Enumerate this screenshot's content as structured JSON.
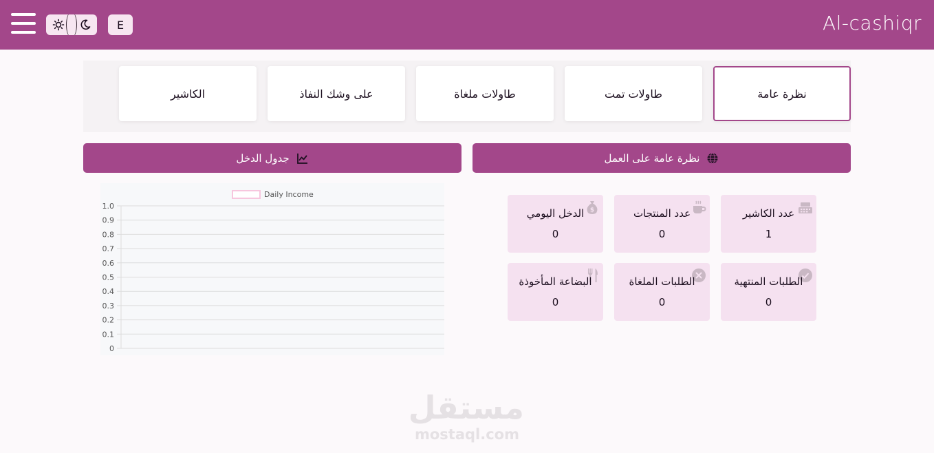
{
  "header": {
    "logo": "Al-cashiqr",
    "lang_button": "E",
    "background_color": "#a3478a"
  },
  "tabs": [
    {
      "label": "نظرة عامة",
      "active": true
    },
    {
      "label": "طاولات تمت",
      "active": false
    },
    {
      "label": "طاولات ملغاة",
      "active": false
    },
    {
      "label": "على وشك النفاذ",
      "active": false
    },
    {
      "label": "الكاشير",
      "active": false
    }
  ],
  "sections": {
    "overview_title": "نظرة عامة على العمل",
    "income_title": "جدول الدخل"
  },
  "stats": [
    {
      "label": "عدد الكاشير",
      "value": "1",
      "icon": "cash-register-icon"
    },
    {
      "label": "عدد المنتجات",
      "value": "0",
      "icon": "coffee-cup-icon"
    },
    {
      "label": "الدخل اليومي",
      "value": "0",
      "icon": "money-bag-icon"
    },
    {
      "label": "الطلبات المنتهية",
      "value": "0",
      "icon": "check-circle-icon"
    },
    {
      "label": "الطلبات الملغاة",
      "value": "0",
      "icon": "x-circle-icon"
    },
    {
      "label": "البضاعة المأخوذة",
      "value": "0",
      "icon": "fork-knife-icon"
    }
  ],
  "chart_data": {
    "type": "line",
    "legend": "Daily Income",
    "legend_position": "top",
    "series": [
      {
        "name": "Daily Income",
        "values": []
      }
    ],
    "yticks": [
      "0",
      "0.1",
      "0.2",
      "0.3",
      "0.4",
      "0.5",
      "0.6",
      "0.7",
      "0.8",
      "0.9",
      "1.0"
    ],
    "ylim": [
      0,
      1
    ],
    "grid": true,
    "colors": {
      "legend_box": "#f7c6de",
      "grid": "#dcdcdc"
    }
  },
  "watermark": {
    "arabic": "مستقل",
    "latin": "mostaql.com"
  }
}
